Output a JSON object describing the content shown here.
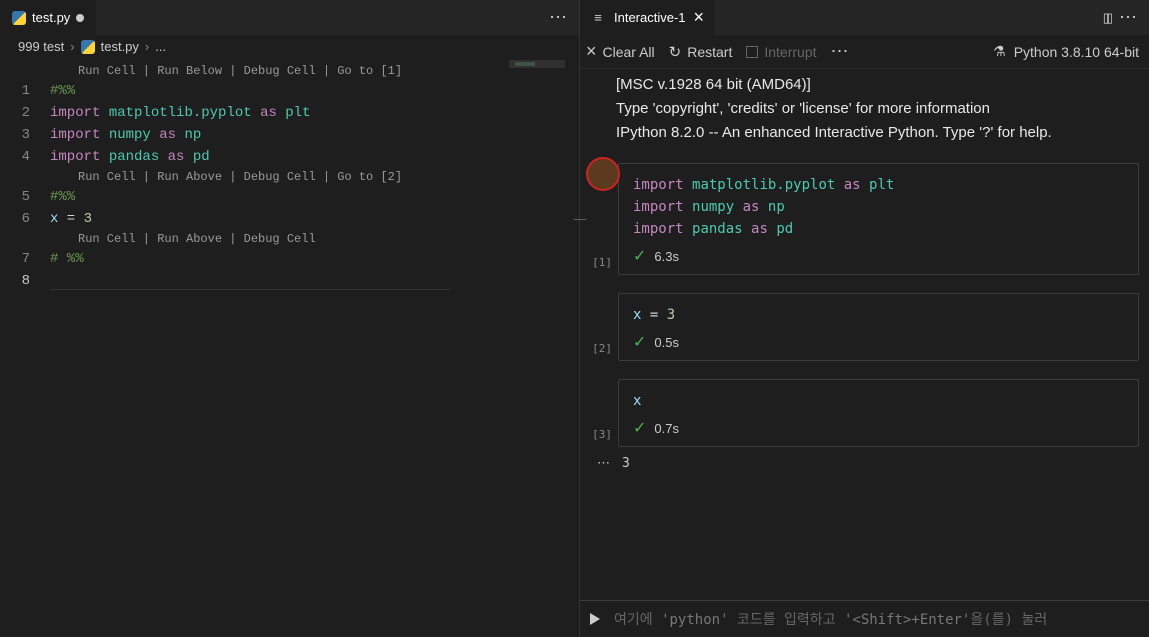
{
  "leftTab": {
    "filename": "test.py"
  },
  "breadcrumb": {
    "folder": "999 test",
    "file": "test.py",
    "tail": "..."
  },
  "codelens": {
    "c1": "Run Cell | Run Below | Debug Cell | Go to [1]",
    "c2": "Run Cell | Run Above | Debug Cell | Go to [2]",
    "c3": "Run Cell | Run Above | Debug Cell"
  },
  "lines": {
    "l1": {
      "n": "1",
      "type": "cm",
      "text": "#%%"
    },
    "l2": {
      "n": "2",
      "kw": "import",
      "mod": "matplotlib.pyplot",
      "as": "as",
      "alias": "plt"
    },
    "l3": {
      "n": "3",
      "kw": "import",
      "mod": "numpy",
      "as": "as",
      "alias": "np"
    },
    "l4": {
      "n": "4",
      "kw": "import",
      "mod": "pandas",
      "as": "as",
      "alias": "pd"
    },
    "l5": {
      "n": "5",
      "type": "cm",
      "text": "#%%"
    },
    "l6": {
      "n": "6",
      "var": "x",
      "op": " = ",
      "num": "3"
    },
    "l7": {
      "n": "7",
      "type": "cm",
      "text": "# %%"
    },
    "l8": {
      "n": "8"
    }
  },
  "rightTab": {
    "title": "Interactive-1"
  },
  "toolbar": {
    "clearAll": "Clear All",
    "restart": "Restart",
    "interrupt": "Interrupt"
  },
  "kernel": {
    "label": "Python 3.8.10 64-bit"
  },
  "banner": {
    "l1": "[MSC v.1928 64 bit (AMD64)]",
    "l2": "Type 'copyright', 'credits' or 'license' for more information",
    "l3": "IPython 8.2.0 -- An enhanced Interactive Python. Type '?' for help."
  },
  "cells": {
    "c1": {
      "index": "[1]",
      "imp1": {
        "kw": "import",
        "mod": "matplotlib.pyplot",
        "as": "as",
        "alias": "plt"
      },
      "imp2": {
        "kw": "import",
        "mod": "numpy",
        "as": "as",
        "alias": "np"
      },
      "imp3": {
        "kw": "import",
        "mod": "pandas",
        "as": "as",
        "alias": "pd"
      },
      "time": "6.3s"
    },
    "c2": {
      "index": "[2]",
      "var": "x",
      "op": " = ",
      "num": "3",
      "time": "0.5s"
    },
    "c3": {
      "index": "[3]",
      "var": "x",
      "time": "0.7s",
      "output": "3"
    }
  },
  "inputBar": {
    "before": "여기에 ",
    "lit1": "'python'",
    "mid": " 코드를 입력하고 ",
    "lit2": "'<Shift>+Enter'",
    "after": "을(를) 눌러"
  }
}
